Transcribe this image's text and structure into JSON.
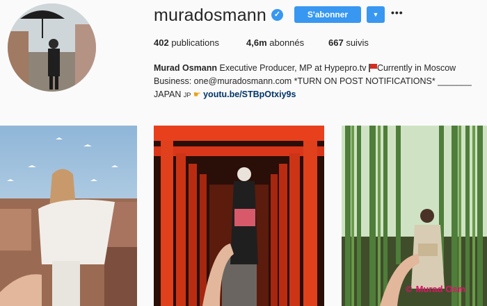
{
  "profile": {
    "username": "muradosmann",
    "verified_badge": "✓",
    "follow_label": "S'abonner",
    "dropdown_glyph": "▼",
    "more_glyph": "•••",
    "stats": {
      "posts_count": "402",
      "posts_label": "publications",
      "followers_count": "4,6m",
      "followers_label": "abonnés",
      "following_count": "667",
      "following_label": "suivis"
    },
    "bio": {
      "name": "Murad Osmann",
      "line1_text": "Executive Producer, MP at Hypepro.tv",
      "line1_suffix": "Currently in Moscow",
      "line2_text": "Business: one@muradosmann.com *TURN ON POST NOTIFICATIONS* _______",
      "line3_prefix": "JAPAN",
      "line3_flag_text": "JP",
      "link": "youtu.be/STBpOtxiy9s"
    }
  },
  "watermark": {
    "copyright": "©",
    "text": "Murad Osm"
  },
  "colors": {
    "accent": "#3897f0",
    "link": "#003569",
    "watermark": "#e0156b",
    "flag": "#d62d20"
  }
}
